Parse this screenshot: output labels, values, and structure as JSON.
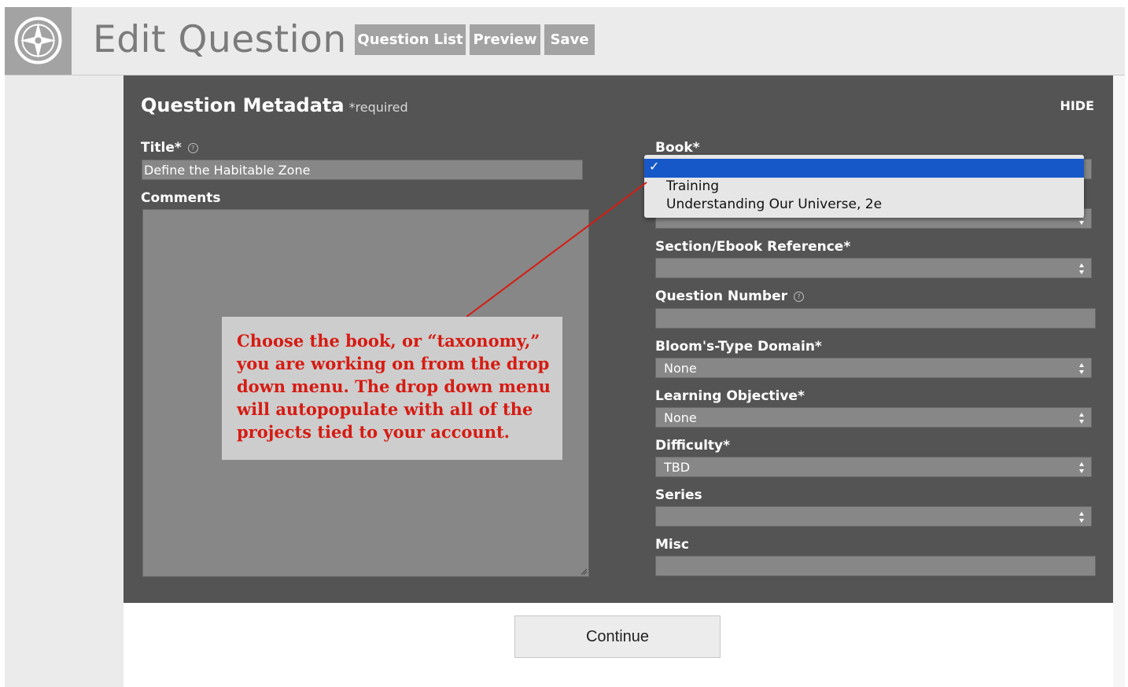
{
  "header": {
    "title": "Edit Question",
    "buttons": [
      "Question List",
      "Preview",
      "Save"
    ]
  },
  "panel": {
    "title": "Question Metadata",
    "required_note": "*required",
    "hide_label": "HIDE"
  },
  "form": {
    "title_label": "Title*",
    "title_value": "Define the Habitable Zone",
    "comments_label": "Comments",
    "book_label": "Book*",
    "section_label": "Section/Ebook Reference*",
    "question_number_label": "Question Number",
    "blooms_label": "Bloom's-Type Domain*",
    "blooms_value": "None",
    "learning_objective_label": "Learning Objective*",
    "learning_objective_value": "None",
    "difficulty_label": "Difficulty*",
    "difficulty_value": "TBD",
    "series_label": "Series",
    "misc_label": "Misc"
  },
  "book_dropdown": {
    "options": [
      "Training",
      "Understanding Our Universe, 2e"
    ]
  },
  "callout": {
    "text": "Choose the book, or “taxonomy,” you are working on from the drop down menu. The drop down menu will autopopulate with all of the projects tied to your account."
  },
  "continue_label": "Continue",
  "colors": {
    "panel_bg": "#545454",
    "field_bg": "#878787",
    "dropdown_highlight": "#1758c9",
    "callout_text": "#d61b12",
    "arrow": "#d61b12"
  }
}
